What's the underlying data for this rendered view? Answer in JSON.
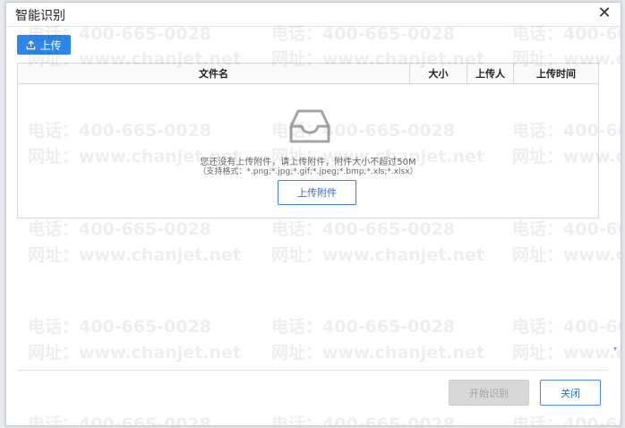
{
  "dialog": {
    "title": "智能识别",
    "close_icon": "close-icon"
  },
  "toolbar": {
    "upload_label": "上传",
    "upload_icon": "upload-icon"
  },
  "table": {
    "columns": [
      "文件名",
      "大小",
      "上传人",
      "上传时间"
    ],
    "empty": {
      "icon": "inbox-icon",
      "message": "您还没有上传附件，请上传附件，附件大小不超过50M",
      "formats": "（支持格式：*.png;*.jpg;*.gif;*.jpeg;*.bmp;*.xls;*.xlsx）",
      "attach_label": "上传附件"
    }
  },
  "footer": {
    "start_label": "开始识别",
    "close_label": "关闭"
  },
  "watermark": {
    "phone": "电话：400-665-0028",
    "website": "网址：www.chanjet.net"
  }
}
